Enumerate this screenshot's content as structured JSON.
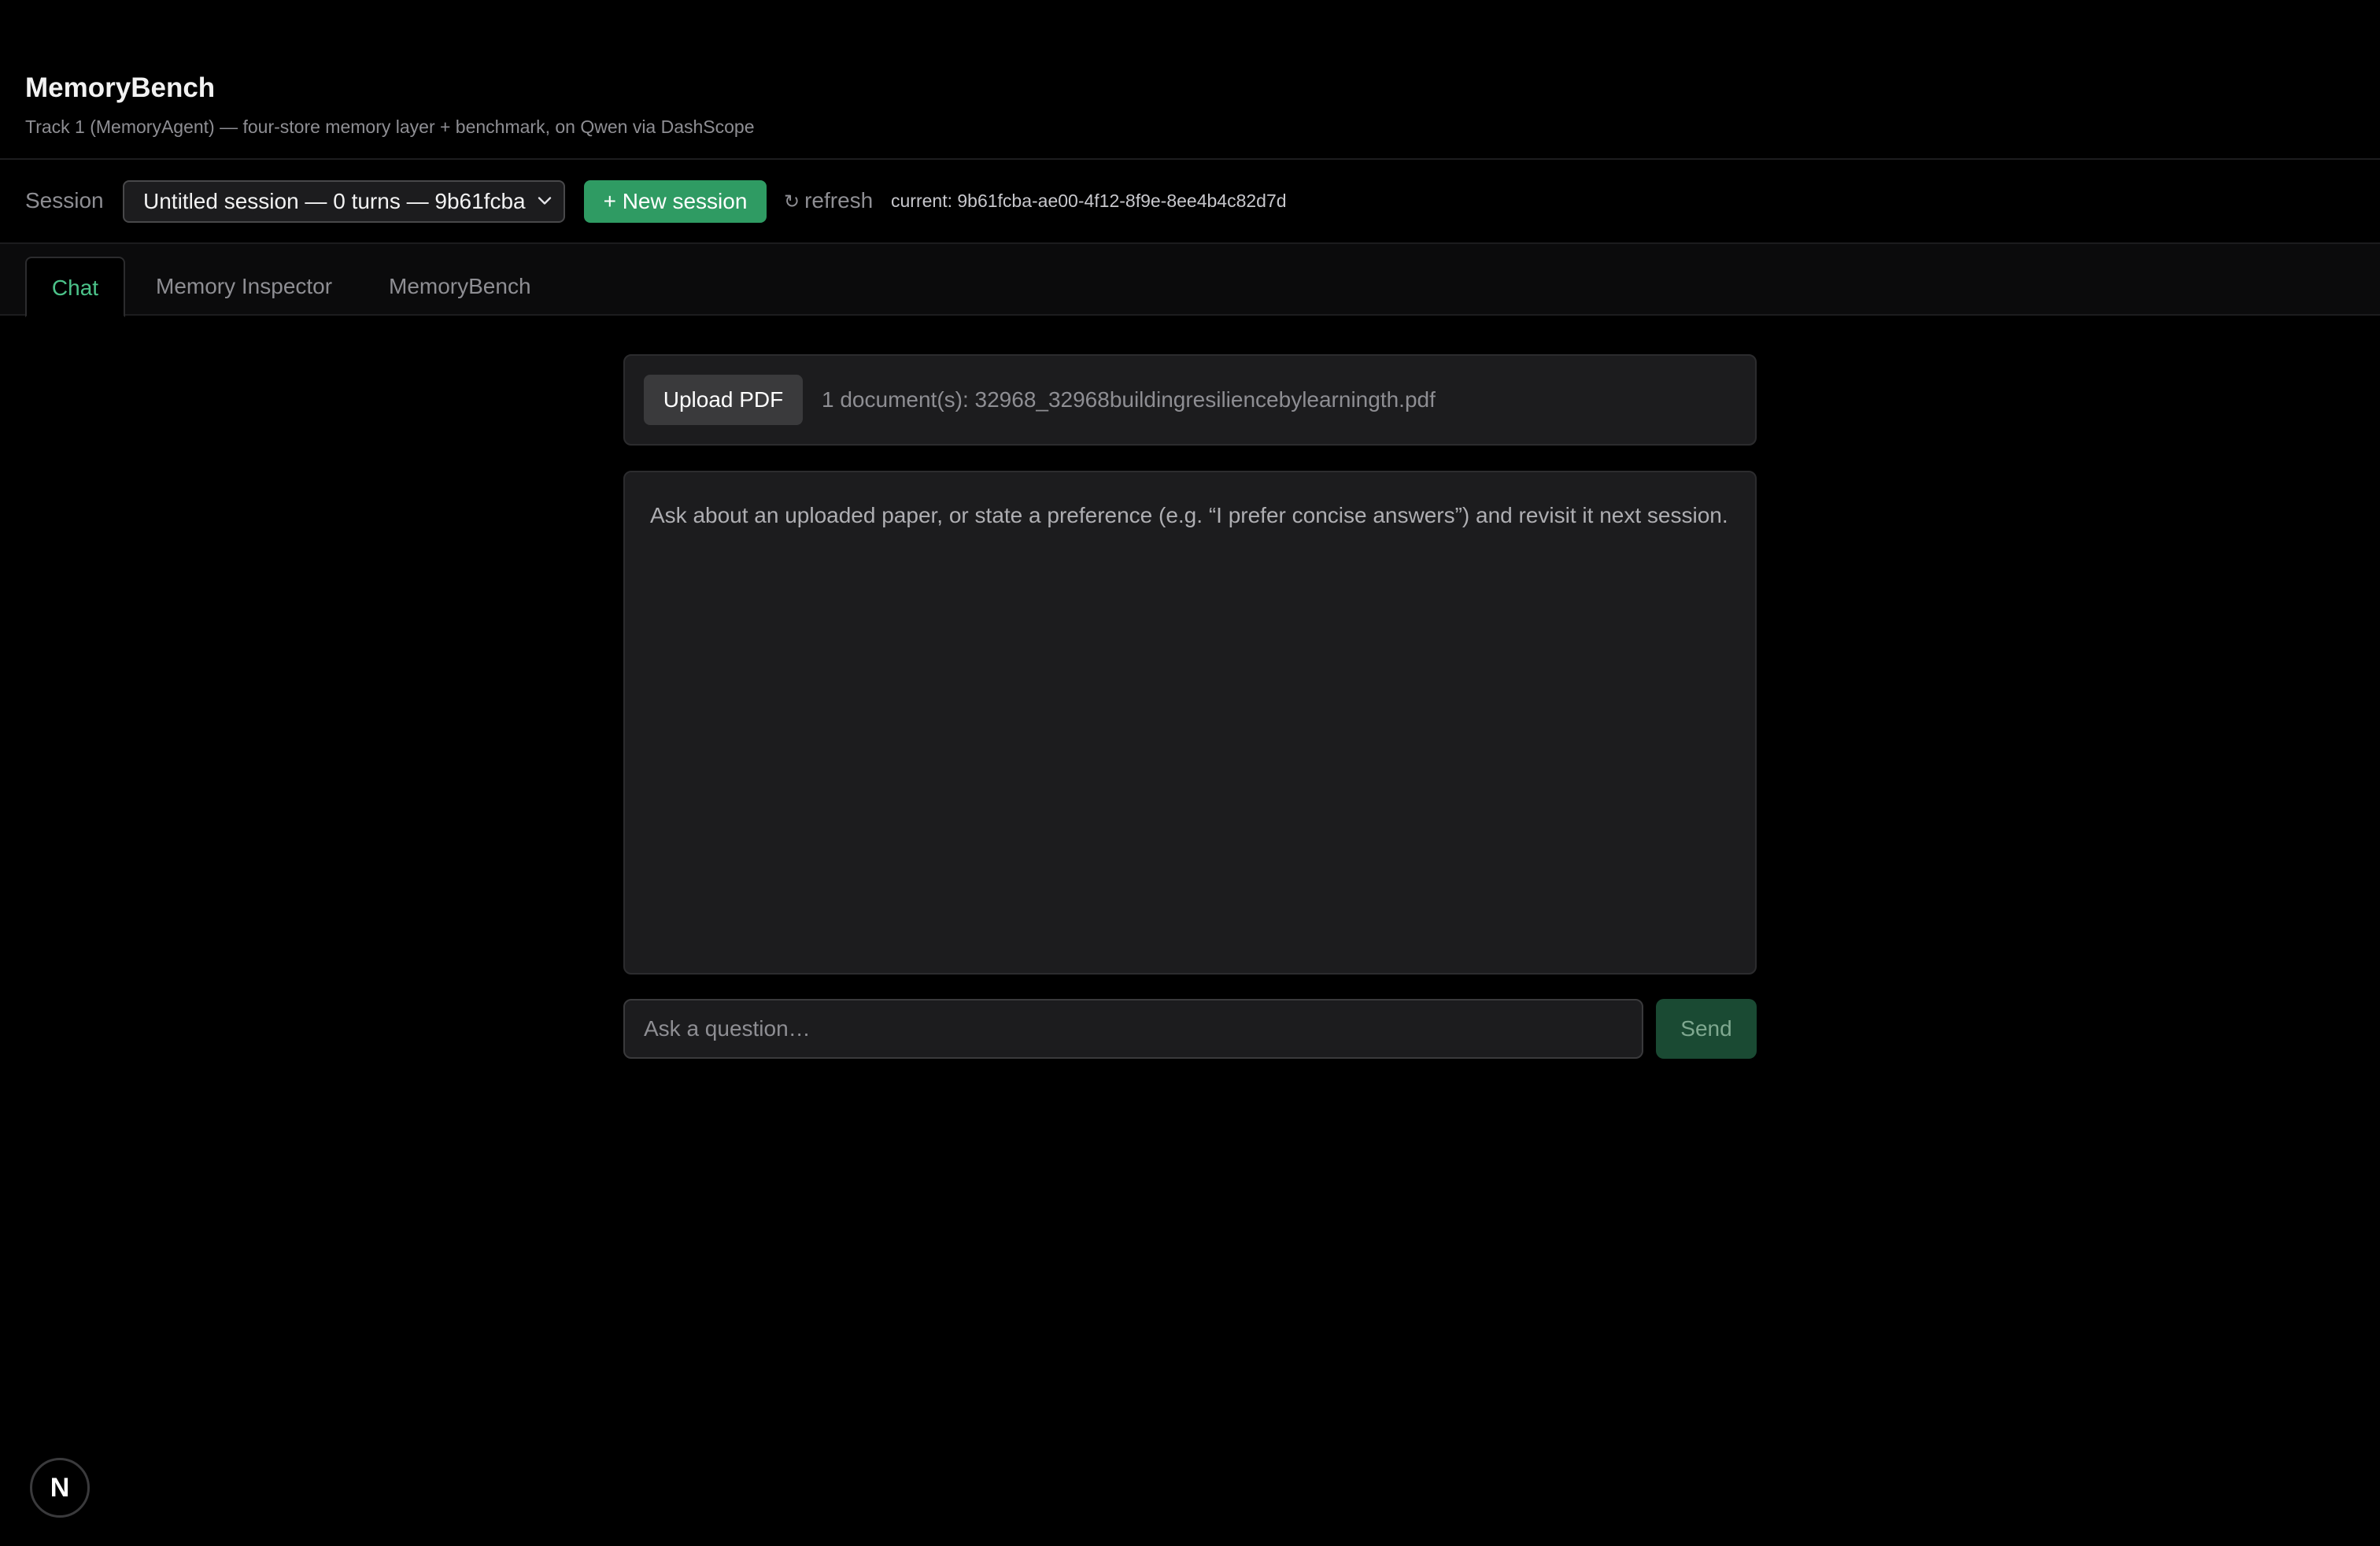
{
  "header": {
    "title": "MemoryBench",
    "subtitle": "Track 1 (MemoryAgent) — four-store memory layer + benchmark, on Qwen via DashScope"
  },
  "session_bar": {
    "label": "Session",
    "selected_session": "Untitled session — 0 turns — 9b61fcba",
    "new_session_label": "+ New session",
    "refresh_glyph": "↻",
    "refresh_label": "refresh",
    "current_id": "current: 9b61fcba-ae00-4f12-8f9e-8ee4b4c82d7d"
  },
  "tabs": [
    {
      "label": "Chat",
      "active": true
    },
    {
      "label": "Memory Inspector",
      "active": false
    },
    {
      "label": "MemoryBench",
      "active": false
    }
  ],
  "upload": {
    "button_label": "Upload PDF",
    "status": "1 document(s): 32968_32968buildingresiliencebylearningth.pdf"
  },
  "chat": {
    "placeholder": "Ask about an uploaded paper, or state a preference (e.g. “I prefer concise answers”) and revisit it next session."
  },
  "composer": {
    "input_placeholder": "Ask a question…",
    "input_value": "",
    "send_label": "Send"
  },
  "badge": {
    "letter": "N"
  },
  "colors": {
    "background": "#000000",
    "accent_green": "#2f9b63",
    "active_tab_text": "#4cc38a",
    "panel": "#1c1c1e",
    "send_disabled": "#1a4a33"
  },
  "icons": {
    "select_chevron": "chevron-down-icon",
    "refresh": "refresh-icon",
    "badge": "next-logo-icon"
  }
}
